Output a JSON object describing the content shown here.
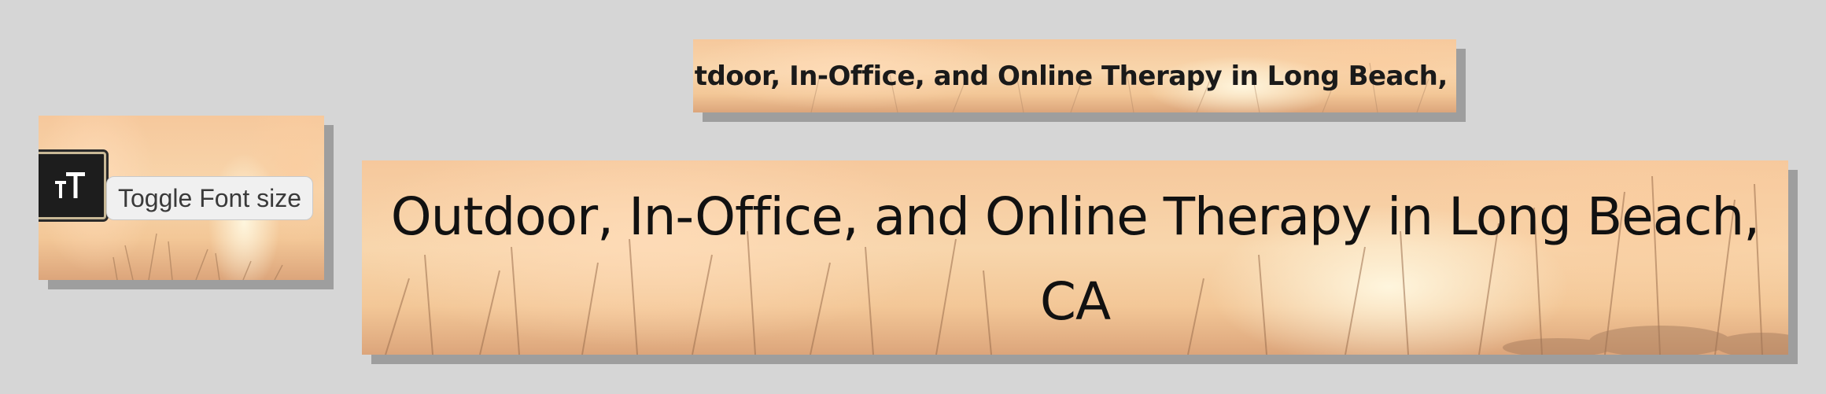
{
  "toggle": {
    "icon": "text-size-icon",
    "label": "Toggle Font size"
  },
  "heading": {
    "small": "Outdoor, In-Office, and Online Therapy in Long Beach, CA",
    "large": "Outdoor, In-Office, and Online Therapy in Long Beach, CA"
  },
  "colors": {
    "background": "#d6d6d6",
    "shadow": "#9e9e9e",
    "button": "#1d1d1d",
    "button_border": "#c8b896",
    "sky_warm": "#f6c89c"
  }
}
